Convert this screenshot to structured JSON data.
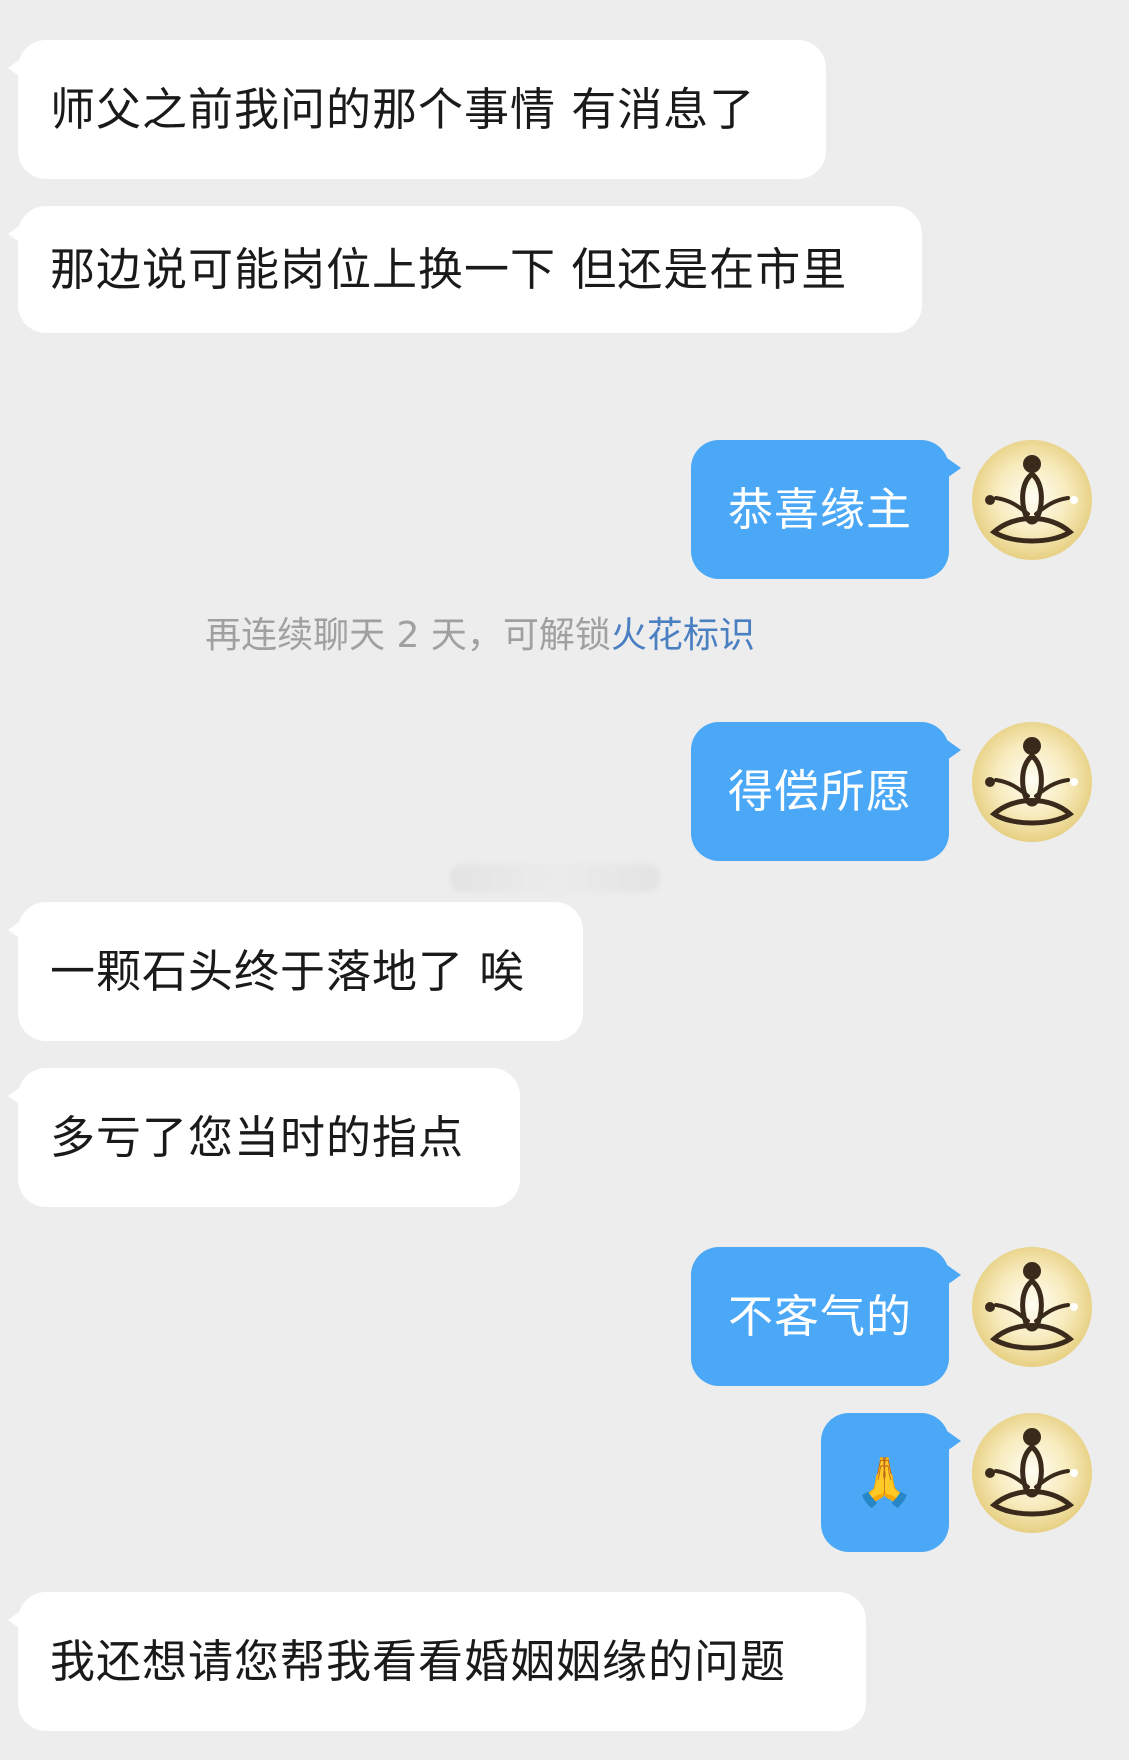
{
  "messages": {
    "m1": "师父之前我问的那个事情 有消息了",
    "m2": "那边说可能岗位上换一下 但还是在市里",
    "m3": "恭喜缘主",
    "m4": "得偿所愿",
    "m5": "一颗石头终于落地了 唉",
    "m6": "多亏了您当时的指点",
    "m7": "不客气的",
    "m8": "🙏",
    "m9": "我还想请您帮我看看婚姻姻缘的问题"
  },
  "notice": {
    "prefix": "再连续聊天 2 天，可解锁",
    "highlight": "火花标识"
  },
  "colors": {
    "background": "#ededed",
    "incoming_bubble": "#ffffff",
    "outgoing_bubble": "#4aa8f7",
    "notice_text": "#a0a0a0",
    "notice_highlight": "#4a7fc1"
  },
  "icons": {
    "avatar": "meditation-figure-icon"
  }
}
